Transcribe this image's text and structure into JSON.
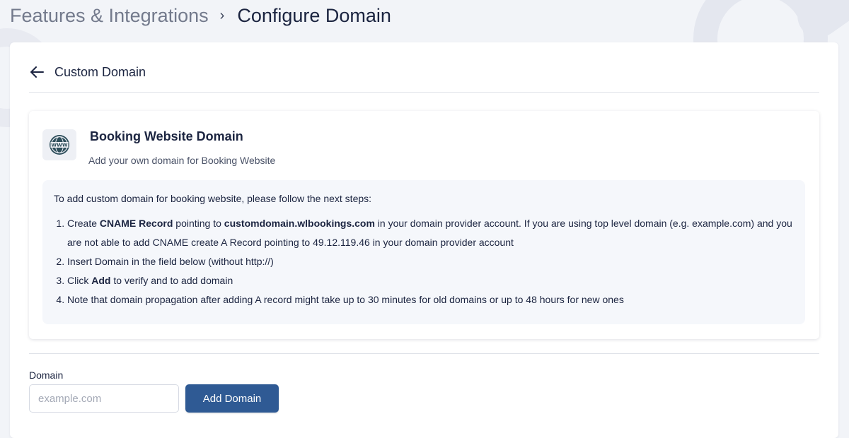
{
  "breadcrumb": {
    "parent": "Features & Integrations",
    "separator": "›",
    "current": "Configure Domain"
  },
  "header": {
    "back_icon": "arrow-left-icon",
    "title": "Custom Domain"
  },
  "section": {
    "icon": "globe-www-icon",
    "title": "Booking Website Domain",
    "subtitle": "Add your own domain for Booking Website"
  },
  "instructions": {
    "intro": "To add custom domain for booking website, please follow the next steps:",
    "step1": {
      "a": "Create ",
      "b": "CNAME Record",
      "c": " pointing to ",
      "d": "customdomain.wlbookings.com",
      "e": " in your domain provider account. If you are using top level domain (e.g. example.com) and you are not able to add CNAME create A Record pointing to 49.12.119.46 in your domain provider account"
    },
    "step2": "Insert Domain in the field below (without http://)",
    "step3": {
      "a": "Click ",
      "b": "Add",
      "c": " to verify and to add domain"
    },
    "step4": "Note that domain propagation after adding A record might take up to 30 minutes for old domains or up to 48 hours for new ones"
  },
  "form": {
    "label": "Domain",
    "placeholder": "example.com",
    "value": "",
    "submit_label": "Add Domain"
  },
  "colors": {
    "primary": "#2f5a94",
    "text": "#1b2440",
    "background": "#f2f4f8"
  }
}
